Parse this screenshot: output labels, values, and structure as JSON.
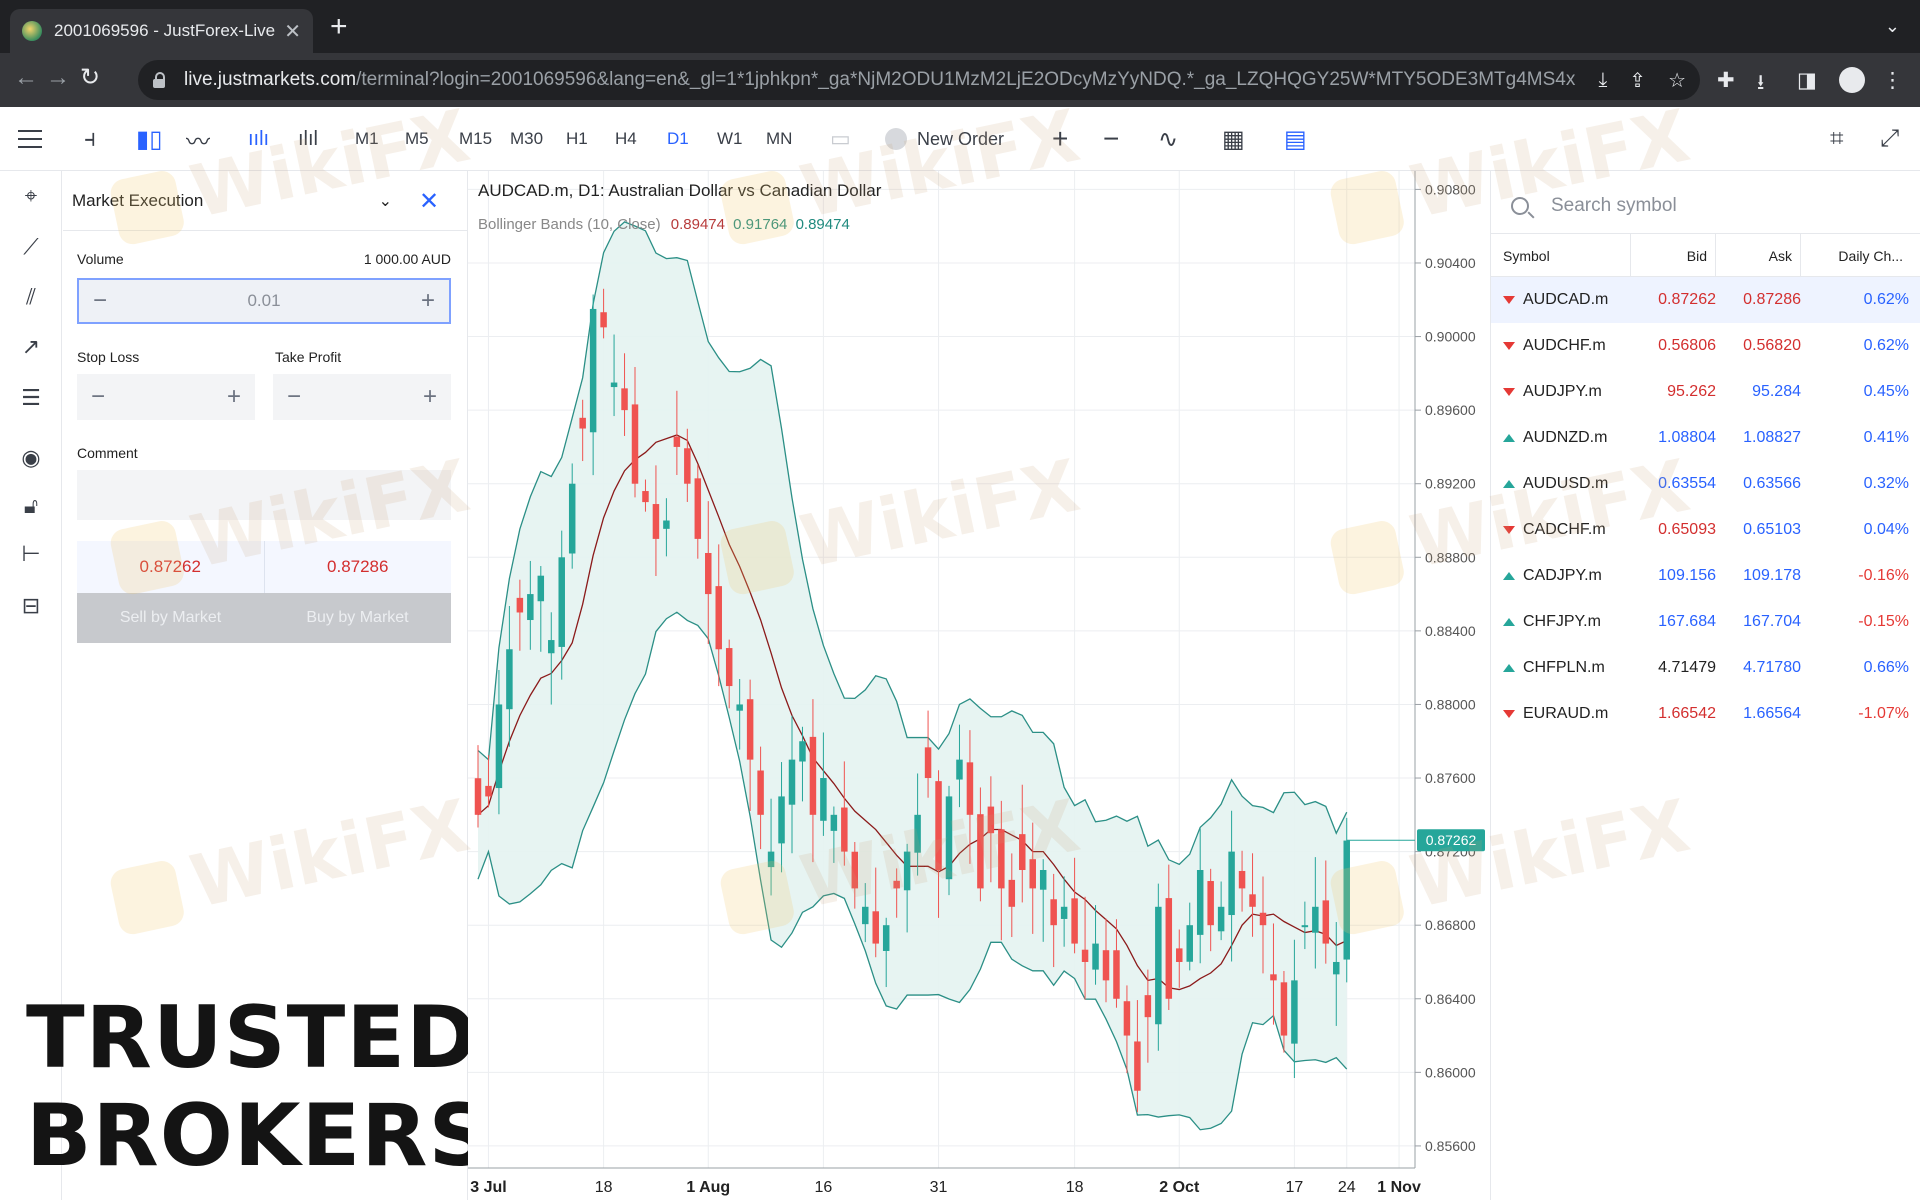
{
  "browser": {
    "tab_title": "2001069596 - JustForex-Live",
    "url_host": "live.justmarkets.com",
    "url_path": "/terminal?login=2001069596&lang=en&_gl=1*1jphkpn*_ga*NjM2ODU1MzM2LjE2ODcyMzYyNDQ.*_ga_LZQHQGY25W*MTY5ODE3MTg4MS4x..."
  },
  "toolbar": {
    "timeframes": [
      "M1",
      "M5",
      "M15",
      "M30",
      "H1",
      "H4",
      "D1",
      "W1",
      "MN"
    ],
    "active_timeframe": "D1",
    "new_order_label": "New Order",
    "zoom_in": "+",
    "zoom_out": "−"
  },
  "order_panel": {
    "execution_type": "Market Execution",
    "volume_label": "Volume",
    "volume_value_text": "1 000.00 AUD",
    "volume_input": "0.01",
    "stop_loss_label": "Stop Loss",
    "take_profit_label": "Take Profit",
    "comment_label": "Comment",
    "sell_price": "0.87262",
    "buy_price": "0.87286",
    "sell_button": "Sell by Market",
    "buy_button": "Buy by Market",
    "minus": "−",
    "plus": "+"
  },
  "brand": {
    "line1": "TRUSTED",
    "line2": "BROKERS"
  },
  "chart": {
    "title": "AUDCAD.m, D1: Australian Dollar vs Canadian Dollar",
    "indicator_label": "Bollinger Bands (10, Close)",
    "indicator_values": [
      "0.89474",
      "0.91764",
      "0.89474"
    ],
    "current_price_label": "0.87262",
    "watermark": "WikiFX"
  },
  "chart_data": {
    "type": "candlestick",
    "symbol": "AUDCAD.m",
    "timeframe": "D1",
    "y_ticks": [
      "0.90800",
      "0.90400",
      "0.90000",
      "0.89600",
      "0.89200",
      "0.88800",
      "0.88400",
      "0.88000",
      "0.87600",
      "0.87200",
      "0.86800",
      "0.86400",
      "0.86000",
      "0.85600"
    ],
    "ylim": [
      0.8548,
      0.909
    ],
    "x_ticks": [
      {
        "label": "3 Jul",
        "i": 1,
        "bold": true
      },
      {
        "label": "18",
        "i": 12
      },
      {
        "label": "1 Aug",
        "i": 22,
        "bold": true
      },
      {
        "label": "16",
        "i": 33
      },
      {
        "label": "31",
        "i": 44
      },
      {
        "label": "18",
        "i": 57
      },
      {
        "label": "2 Oct",
        "i": 67,
        "bold": true
      },
      {
        "label": "17",
        "i": 78
      },
      {
        "label": "24",
        "i": 83
      },
      {
        "label": "1 Nov",
        "i": 88,
        "bold": true
      }
    ],
    "last_price": 0.87262,
    "close": [
      0.874,
      0.875,
      0.88,
      0.883,
      0.885,
      0.886,
      0.887,
      0.8835,
      0.888,
      0.892,
      0.895,
      0.9015,
      0.9005,
      0.8975,
      0.896,
      0.892,
      0.891,
      0.889,
      0.89,
      0.894,
      0.892,
      0.889,
      0.886,
      0.883,
      0.881,
      0.88,
      0.877,
      0.874,
      0.872,
      0.875,
      0.877,
      0.878,
      0.874,
      0.876,
      0.874,
      0.872,
      0.87,
      0.869,
      0.867,
      0.868,
      0.87,
      0.872,
      0.874,
      0.876,
      0.871,
      0.875,
      0.877,
      0.874,
      0.87,
      0.873,
      0.87,
      0.869,
      0.871,
      0.87,
      0.871,
      0.868,
      0.869,
      0.867,
      0.866,
      0.867,
      0.865,
      0.864,
      0.862,
      0.859,
      0.863,
      0.869,
      0.864,
      0.866,
      0.868,
      0.871,
      0.868,
      0.869,
      0.872,
      0.87,
      0.869,
      0.868,
      0.865,
      0.862,
      0.865,
      0.868,
      0.869,
      0.867,
      0.866,
      0.8726
    ],
    "series": [
      {
        "name": "Bollinger middle",
        "color": "#8b1a1a"
      },
      {
        "name": "Bollinger upper/lower",
        "color": "#2b8f86"
      }
    ],
    "colors": {
      "up": "#26a69a",
      "down": "#ef5350",
      "band_fill": "#e4f3f1",
      "grid": "#eceef1"
    }
  },
  "watchlist": {
    "search_placeholder": "Search symbol",
    "columns": [
      "Symbol",
      "Bid",
      "Ask",
      "Daily Ch..."
    ],
    "rows": [
      {
        "symbol": "AUDCAD.m",
        "bid": "0.87262",
        "ask": "0.87286",
        "change": "0.62%",
        "dir": "down",
        "bidc": "c-red",
        "askc": "c-red",
        "neg": false
      },
      {
        "symbol": "AUDCHF.m",
        "bid": "0.56806",
        "ask": "0.56820",
        "change": "0.62%",
        "dir": "down",
        "bidc": "c-red",
        "askc": "c-red",
        "neg": false
      },
      {
        "symbol": "AUDJPY.m",
        "bid": "95.262",
        "ask": "95.284",
        "change": "0.45%",
        "dir": "down",
        "bidc": "c-red",
        "askc": "c-blue",
        "neg": false
      },
      {
        "symbol": "AUDNZD.m",
        "bid": "1.08804",
        "ask": "1.08827",
        "change": "0.41%",
        "dir": "up",
        "bidc": "c-blue",
        "askc": "c-blue",
        "neg": false
      },
      {
        "symbol": "AUDUSD.m",
        "bid": "0.63554",
        "ask": "0.63566",
        "change": "0.32%",
        "dir": "up",
        "bidc": "c-blue",
        "askc": "c-blue",
        "neg": false
      },
      {
        "symbol": "CADCHF.m",
        "bid": "0.65093",
        "ask": "0.65103",
        "change": "0.04%",
        "dir": "down",
        "bidc": "c-red",
        "askc": "c-blue",
        "neg": false
      },
      {
        "symbol": "CADJPY.m",
        "bid": "109.156",
        "ask": "109.178",
        "change": "-0.16%",
        "dir": "up",
        "bidc": "c-blue",
        "askc": "c-blue",
        "neg": true
      },
      {
        "symbol": "CHFJPY.m",
        "bid": "167.684",
        "ask": "167.704",
        "change": "-0.15%",
        "dir": "up",
        "bidc": "c-blue",
        "askc": "c-blue",
        "neg": true
      },
      {
        "symbol": "CHFPLN.m",
        "bid": "4.71479",
        "ask": "4.71780",
        "change": "0.66%",
        "dir": "up",
        "bidc": "c-black",
        "askc": "c-blue",
        "neg": false
      },
      {
        "symbol": "EURAUD.m",
        "bid": "1.66542",
        "ask": "1.66564",
        "change": "-1.07%",
        "dir": "down",
        "bidc": "c-red",
        "askc": "c-blue",
        "neg": true
      }
    ]
  }
}
